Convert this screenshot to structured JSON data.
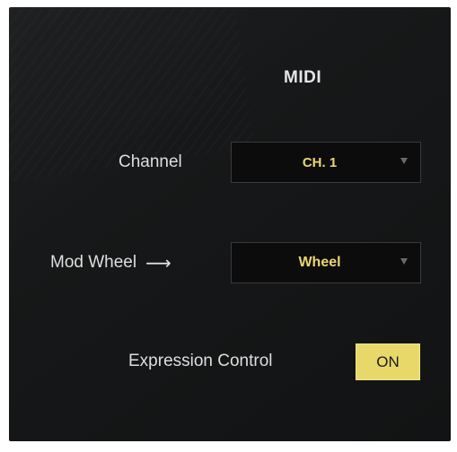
{
  "panel": {
    "title": "MIDI"
  },
  "channel": {
    "label": "Channel",
    "value": "CH. 1"
  },
  "mod_wheel": {
    "label": "Mod Wheel",
    "arrow": "⟶",
    "value": "Wheel"
  },
  "expression": {
    "label": "Expression Control",
    "toggle_state": "ON"
  },
  "colors": {
    "accent": "#e8d86a",
    "value_text": "#ebd66e",
    "panel_bg": "#161819"
  },
  "icons": {
    "dropdown_caret": "caret-down-icon",
    "mapping_arrow": "right-arrow-icon"
  }
}
